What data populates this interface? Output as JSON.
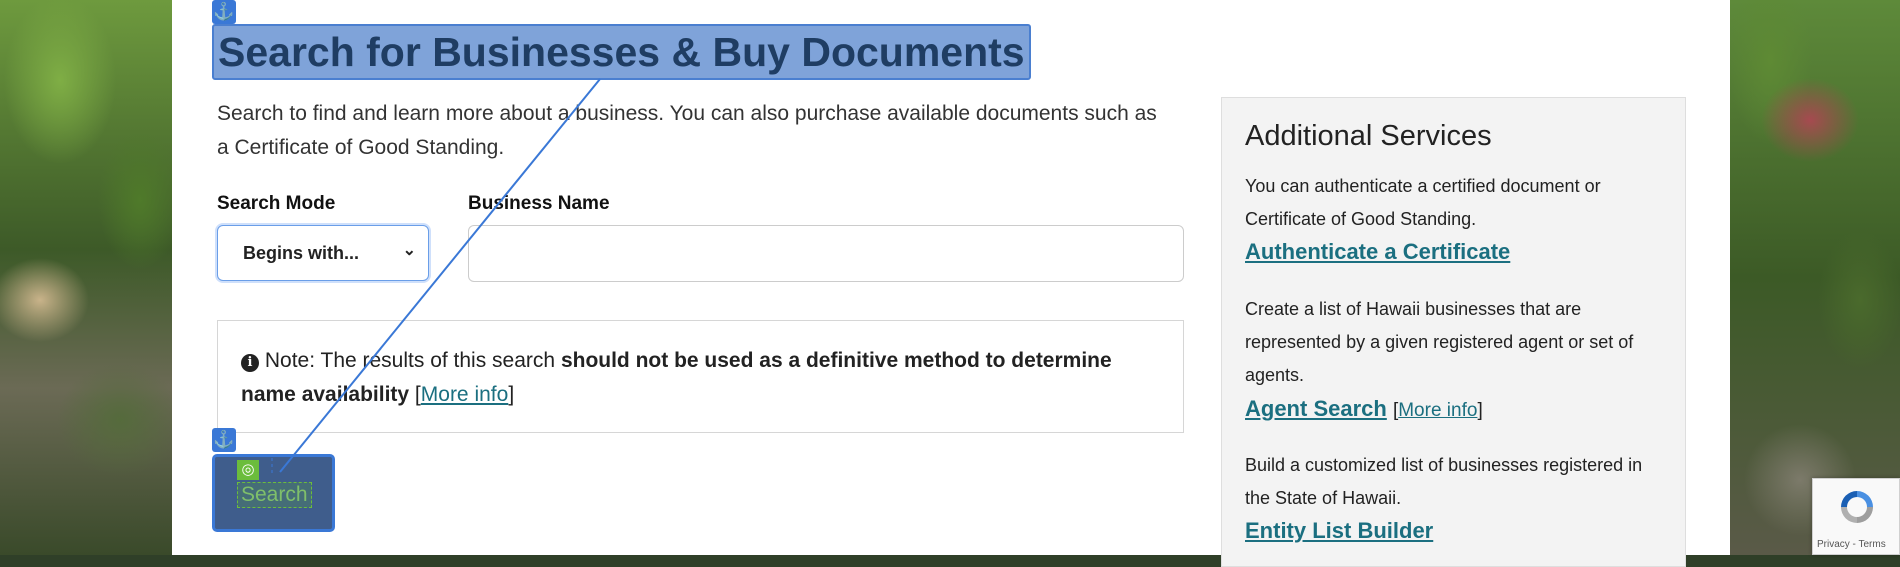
{
  "page": {
    "title": "Search for Businesses & Buy Documents",
    "intro": "Search to find and learn more about a business. You can also purchase available documents such as a Certificate of Good Standing."
  },
  "search_form": {
    "mode_label": "Search Mode",
    "mode_value": "Begins with...",
    "name_label": "Business Name",
    "name_value": "",
    "button_label": "Search"
  },
  "note": {
    "prefix": "Note: The results of this search ",
    "emphasis": "should not be used as a definitive method to determine name availability",
    "link_text": "More info"
  },
  "sidebar": {
    "title": "Additional Services",
    "sections": [
      {
        "text": "You can authenticate a certified document or Certificate of Good Standing.",
        "link": "Authenticate a Certificate"
      },
      {
        "text": "Create a list of Hawaii businesses that are represented by a given registered agent or set of agents.",
        "link": "Agent Search",
        "more_info": "More info"
      },
      {
        "text": "Build a customized list of businesses registered in the State of Hawaii.",
        "link": "Entity List Builder"
      }
    ]
  },
  "recaptcha": {
    "terms": "Privacy - Terms"
  },
  "icons": {
    "anchor": "anchor-icon",
    "info": "info-circle-icon",
    "target": "target-icon",
    "chevron": "chevron-down-icon"
  },
  "colors": {
    "title_highlight": "#7fa3d9",
    "link": "#1b6f80",
    "annotation_blue": "#3a78d6",
    "annotation_green": "#6bbd3c"
  }
}
